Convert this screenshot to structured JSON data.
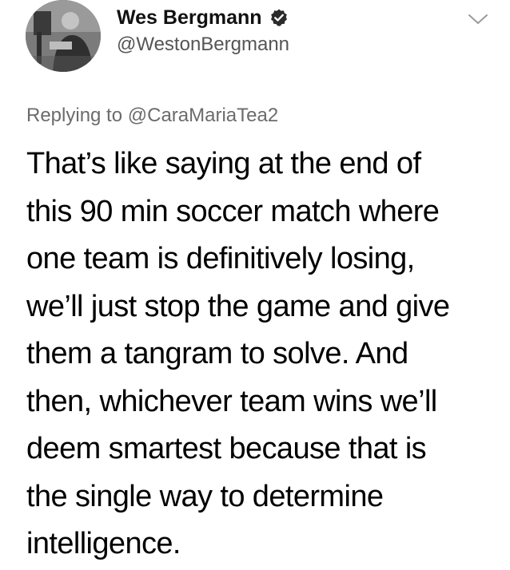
{
  "author": {
    "display_name": "Wes Bergmann",
    "handle": "@WestonBergmann",
    "verified": true,
    "avatar_icon": "avatar-photo"
  },
  "reply": {
    "prefix": "Replying to",
    "mention": "@CaraMariaTea2"
  },
  "tweet": {
    "lines": [
      "That’s like saying at the end of",
      "this 90 min soccer match where",
      "one team is definitively losing,",
      "we’ll just stop the game and give",
      "them a tangram to solve. And",
      "then, whichever team wins we’ll",
      "deem smartest because that is",
      "the single way to determine",
      "intelligence."
    ]
  },
  "icons": {
    "verified": "verified-badge-icon",
    "menu": "chevron-down-icon"
  },
  "colors": {
    "text": "#000000",
    "secondary_text": "#6b6b6b",
    "badge": "#2b2b2b"
  }
}
